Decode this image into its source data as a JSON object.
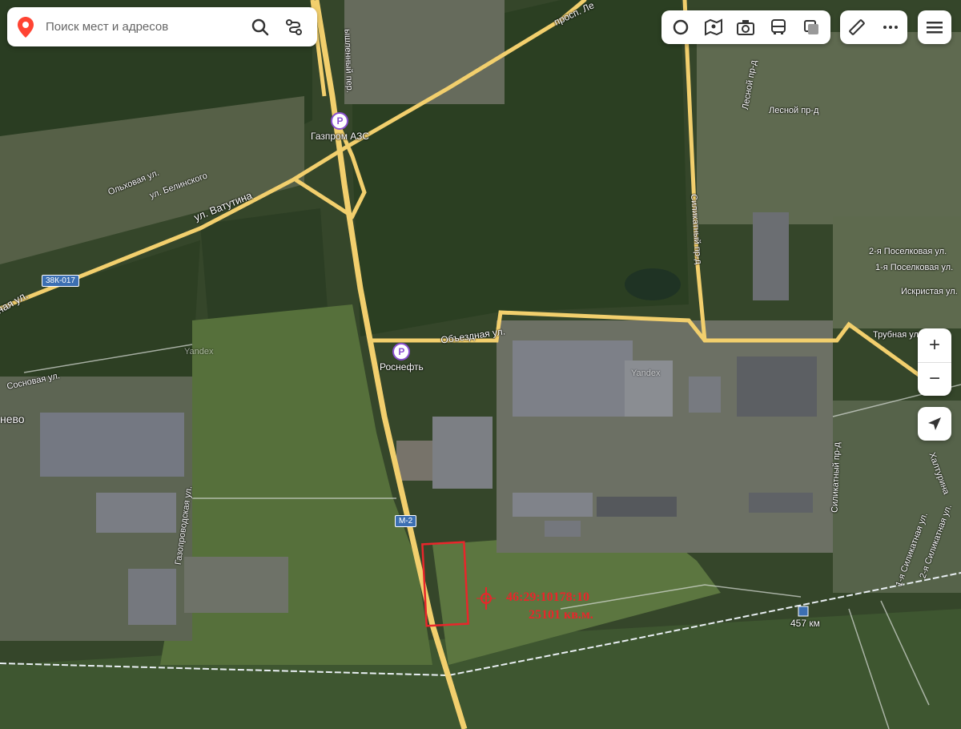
{
  "search": {
    "placeholder": "Поиск мест и адресов"
  },
  "icons": {
    "search_pin": "location-pin-icon",
    "search": "search-icon",
    "route": "route-icon",
    "layers": [
      "traffic-circle-icon",
      "map-panorama-icon",
      "camera-icon",
      "bus-icon",
      "layers-square-icon"
    ],
    "ruler": "ruler-icon",
    "more": "more-dots-icon",
    "menu": "hamburger-menu-icon",
    "zoom_in": "+",
    "zoom_out": "−",
    "locate": "navigation-arrow-icon"
  },
  "pois": [
    {
      "name": "poi-gazprom",
      "label": "Газпром АЗС"
    },
    {
      "name": "poi-rosneft",
      "label": "Роснефть"
    }
  ],
  "streets": {
    "vatutina": "ул. Ватутина",
    "vatutina_left": "ная ул.",
    "olkhovaya": "Ольховая ул.",
    "belinskogo": "ул. Белинского",
    "sosnovaya": "Сосновая ул.",
    "gazoprovodskaya": "Газопроводская ул.",
    "obyezdnaya": "Объездная ул.",
    "silikatny_pr": "Силикатный пр-д",
    "silikatny_pr2": "Силикатный пр-д",
    "lesnoy_pr": "Лесной пр-д",
    "lesnoy_pr2": "Лесной пр-д",
    "poselkovaya2": "2-я Поселковая ул.",
    "poselkovaya1": "1-я Поселковая ул.",
    "iskristaya": "Искристая ул.",
    "trubnaya": "Трубная ул.",
    "prosp": "просп. Ле",
    "prosp2": "ышленный пер.",
    "silikatnaya1": "1-я Силикатная ул.",
    "silikatnaya2": "2-я Силикатная ул.",
    "khalturina": "Халтурина",
    "nevo": "нево"
  },
  "shields": {
    "road1": "38К-017",
    "road2": "М-2"
  },
  "railway": {
    "station": "457 км"
  },
  "annotation": {
    "cadastral": "46:29:10178:10",
    "area": "25101 кв.м."
  },
  "watermarks": [
    "Yandex",
    "Yandex"
  ],
  "colors": {
    "road": "#f2cf6d",
    "annotation": "#e8262b",
    "poi": "#8a4fd0"
  }
}
